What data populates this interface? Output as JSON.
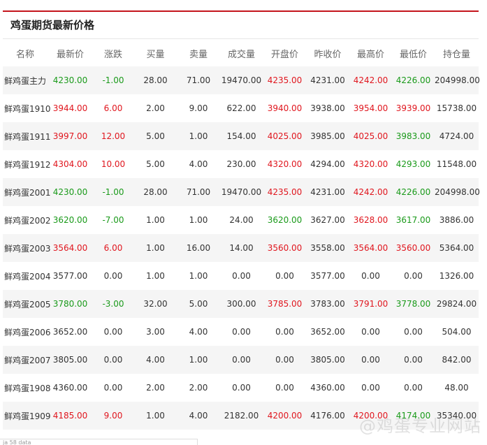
{
  "panel": {
    "title": "鸡蛋期货最新价格"
  },
  "table": {
    "headers": [
      "名称",
      "最新价",
      "涨跌",
      "买量",
      "卖量",
      "成交量",
      "开盘价",
      "昨收价",
      "最高价",
      "最低价",
      "持仓量"
    ],
    "rows": [
      {
        "name": "鲜鸡蛋主力",
        "latest": "4230.00",
        "latest_c": "down",
        "change": "-1.00",
        "change_c": "down",
        "bid": "28.00",
        "ask": "71.00",
        "volume": "19470.00",
        "open": "4235.00",
        "open_c": "up",
        "prev": "4231.00",
        "high": "4242.00",
        "high_c": "up",
        "low": "4226.00",
        "low_c": "down",
        "oi": "204998.00"
      },
      {
        "name": "鲜鸡蛋1910",
        "latest": "3944.00",
        "latest_c": "up",
        "change": "6.00",
        "change_c": "up",
        "bid": "2.00",
        "ask": "9.00",
        "volume": "622.00",
        "open": "3940.00",
        "open_c": "up",
        "prev": "3938.00",
        "high": "3954.00",
        "high_c": "up",
        "low": "3939.00",
        "low_c": "up",
        "oi": "15738.00"
      },
      {
        "name": "鲜鸡蛋1911",
        "latest": "3997.00",
        "latest_c": "up",
        "change": "12.00",
        "change_c": "up",
        "bid": "5.00",
        "ask": "1.00",
        "volume": "154.00",
        "open": "4025.00",
        "open_c": "up",
        "prev": "3985.00",
        "high": "4025.00",
        "high_c": "up",
        "low": "3983.00",
        "low_c": "down",
        "oi": "4724.00"
      },
      {
        "name": "鲜鸡蛋1912",
        "latest": "4304.00",
        "latest_c": "up",
        "change": "10.00",
        "change_c": "up",
        "bid": "5.00",
        "ask": "4.00",
        "volume": "230.00",
        "open": "4320.00",
        "open_c": "up",
        "prev": "4294.00",
        "high": "4320.00",
        "high_c": "up",
        "low": "4293.00",
        "low_c": "down",
        "oi": "11548.00"
      },
      {
        "name": "鲜鸡蛋2001",
        "latest": "4230.00",
        "latest_c": "down",
        "change": "-1.00",
        "change_c": "down",
        "bid": "28.00",
        "ask": "71.00",
        "volume": "19470.00",
        "open": "4235.00",
        "open_c": "up",
        "prev": "4231.00",
        "high": "4242.00",
        "high_c": "up",
        "low": "4226.00",
        "low_c": "down",
        "oi": "204998.00"
      },
      {
        "name": "鲜鸡蛋2002",
        "latest": "3620.00",
        "latest_c": "down",
        "change": "-7.00",
        "change_c": "down",
        "bid": "1.00",
        "ask": "1.00",
        "volume": "24.00",
        "open": "3620.00",
        "open_c": "down",
        "prev": "3627.00",
        "high": "3628.00",
        "high_c": "up",
        "low": "3617.00",
        "low_c": "down",
        "oi": "3886.00"
      },
      {
        "name": "鲜鸡蛋2003",
        "latest": "3564.00",
        "latest_c": "up",
        "change": "6.00",
        "change_c": "up",
        "bid": "1.00",
        "ask": "16.00",
        "volume": "14.00",
        "open": "3560.00",
        "open_c": "up",
        "prev": "3558.00",
        "high": "3564.00",
        "high_c": "up",
        "low": "3560.00",
        "low_c": "up",
        "oi": "5364.00"
      },
      {
        "name": "鲜鸡蛋2004",
        "latest": "3577.00",
        "latest_c": "flat",
        "change": "0.00",
        "change_c": "flat",
        "bid": "1.00",
        "ask": "1.00",
        "volume": "0.00",
        "open": "0.00",
        "open_c": "flat",
        "prev": "3577.00",
        "high": "0.00",
        "high_c": "flat",
        "low": "0.00",
        "low_c": "flat",
        "oi": "1326.00"
      },
      {
        "name": "鲜鸡蛋2005",
        "latest": "3780.00",
        "latest_c": "down",
        "change": "-3.00",
        "change_c": "down",
        "bid": "32.00",
        "ask": "5.00",
        "volume": "300.00",
        "open": "3785.00",
        "open_c": "up",
        "prev": "3783.00",
        "high": "3791.00",
        "high_c": "up",
        "low": "3778.00",
        "low_c": "down",
        "oi": "29824.00"
      },
      {
        "name": "鲜鸡蛋2006",
        "latest": "3652.00",
        "latest_c": "flat",
        "change": "0.00",
        "change_c": "flat",
        "bid": "3.00",
        "ask": "4.00",
        "volume": "0.00",
        "open": "0.00",
        "open_c": "flat",
        "prev": "3652.00",
        "high": "0.00",
        "high_c": "flat",
        "low": "0.00",
        "low_c": "flat",
        "oi": "504.00"
      },
      {
        "name": "鲜鸡蛋2007",
        "latest": "3805.00",
        "latest_c": "flat",
        "change": "0.00",
        "change_c": "flat",
        "bid": "4.00",
        "ask": "1.00",
        "volume": "0.00",
        "open": "0.00",
        "open_c": "flat",
        "prev": "3805.00",
        "high": "0.00",
        "high_c": "flat",
        "low": "0.00",
        "low_c": "flat",
        "oi": "842.00"
      },
      {
        "name": "鲜鸡蛋1908",
        "latest": "4360.00",
        "latest_c": "flat",
        "change": "0.00",
        "change_c": "flat",
        "bid": "2.00",
        "ask": "2.00",
        "volume": "0.00",
        "open": "0.00",
        "open_c": "flat",
        "prev": "4360.00",
        "high": "0.00",
        "high_c": "flat",
        "low": "0.00",
        "low_c": "flat",
        "oi": "48.00"
      },
      {
        "name": "鲜鸡蛋1909",
        "latest": "4185.00",
        "latest_c": "up",
        "change": "9.00",
        "change_c": "up",
        "bid": "1.00",
        "ask": "4.00",
        "volume": "2182.00",
        "open": "4200.00",
        "open_c": "up",
        "prev": "4176.00",
        "high": "4200.00",
        "high_c": "up",
        "low": "4174.00",
        "low_c": "down",
        "oi": "35340.00"
      }
    ]
  },
  "colors": {
    "up": "#e0161e",
    "down": "#1a9a1a",
    "accent": "#c4151c"
  },
  "watermark": "@鸡蛋专业网站",
  "footer_hint": "ja 58 data"
}
